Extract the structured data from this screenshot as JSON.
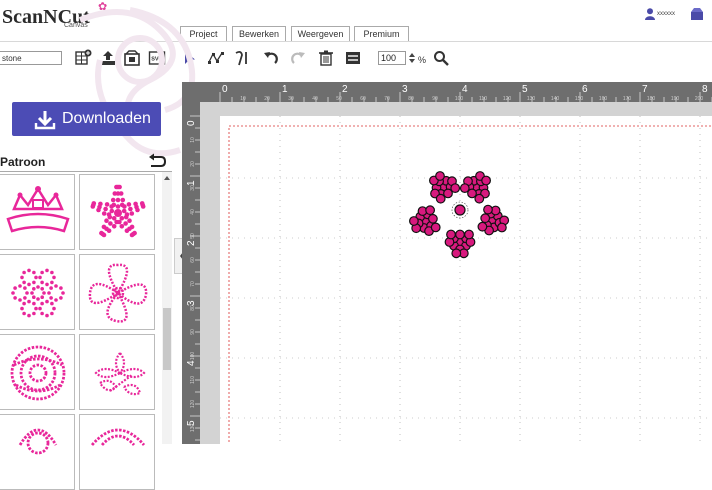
{
  "app": {
    "logo_text": "ScanNCut",
    "logo_sub": "Canvas",
    "user_name": "xxxxxx"
  },
  "tabs": [
    {
      "label": "Project"
    },
    {
      "label": "Bewerken"
    },
    {
      "label": "Weergeven"
    },
    {
      "label": "Premium"
    }
  ],
  "toolbar": {
    "project_name": "stone",
    "zoom_value": "100",
    "zoom_unit": "%",
    "icons": [
      "add-pattern-icon",
      "upload-icon",
      "image-trace-icon",
      "svg-import-icon",
      "select-arrow-icon",
      "node-edit-icon",
      "text-path-icon",
      "undo-icon",
      "redo-icon",
      "delete-icon",
      "layers-icon",
      "magnifier-icon"
    ]
  },
  "left_panel": {
    "download_label": "Downloaden",
    "section_title": "Patroon",
    "patterns": [
      {
        "name": "crown-rhinestone-pattern"
      },
      {
        "name": "star-flower-rhinestone-pattern"
      },
      {
        "name": "dot-flower-circle-pattern"
      },
      {
        "name": "hibiscus-rhinestone-pattern"
      },
      {
        "name": "rose-rhinestone-pattern"
      },
      {
        "name": "lily-bouquet-pattern"
      },
      {
        "name": "rose-bud-pattern"
      },
      {
        "name": "wreath-pattern"
      }
    ]
  },
  "ruler": {
    "top_major": [
      "0",
      "1",
      "2",
      "3",
      "4",
      "5",
      "6",
      "7",
      "8"
    ],
    "top_minor": [
      "10",
      "20",
      "30",
      "40",
      "50",
      "60",
      "70",
      "80",
      "90",
      "100",
      "110",
      "120",
      "130",
      "140",
      "150",
      "160",
      "170",
      "180",
      "190",
      "200"
    ],
    "left_major": [
      "0",
      "1",
      "2",
      "3",
      "4",
      "5"
    ],
    "left_minor": [
      "10",
      "20",
      "30",
      "40",
      "50",
      "60",
      "70",
      "80",
      "90",
      "100",
      "110",
      "120",
      "130"
    ]
  },
  "colors": {
    "accent": "#4c4cb5",
    "rhinestone": "#d8197e",
    "cut_line": "#d93030"
  }
}
